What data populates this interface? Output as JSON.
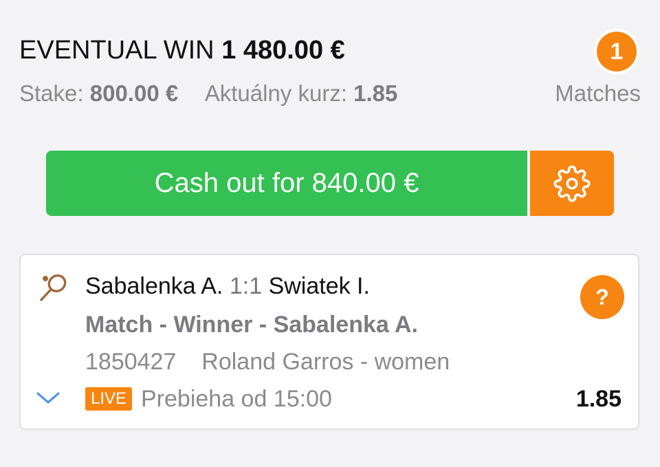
{
  "summary": {
    "win_label": "EVENTUAL WIN",
    "win_amount": "1 480.00 €",
    "stake_label": "Stake:",
    "stake_value": "800.00 €",
    "odds_label": "Aktuálny kurz:",
    "odds_value": "1.85",
    "matches_count": "1",
    "matches_label": "Matches"
  },
  "actions": {
    "cashout_label": "Cash out for 840.00 €",
    "settings_icon": "gear-icon"
  },
  "bet": {
    "sport_icon": "tennis-racket-icon",
    "home_team": "Sabalenka A.",
    "score": "1:1",
    "away_team": "Swiatek I.",
    "market": "Match - Winner - Sabalenka A.",
    "event_id": "1850427",
    "tournament": "Roland Garros - women",
    "help_label": "?",
    "expand_icon": "chevron-down-icon",
    "live_label": "LIVE",
    "status": "Prebieha od 15:00",
    "odds": "1.85"
  },
  "colors": {
    "background": "#f3f3f5",
    "green": "#34c052",
    "orange": "#f78511",
    "gray_text": "#8a8a8f",
    "chevron_blue": "#4a90e2",
    "icon_brown": "#a0683a"
  }
}
